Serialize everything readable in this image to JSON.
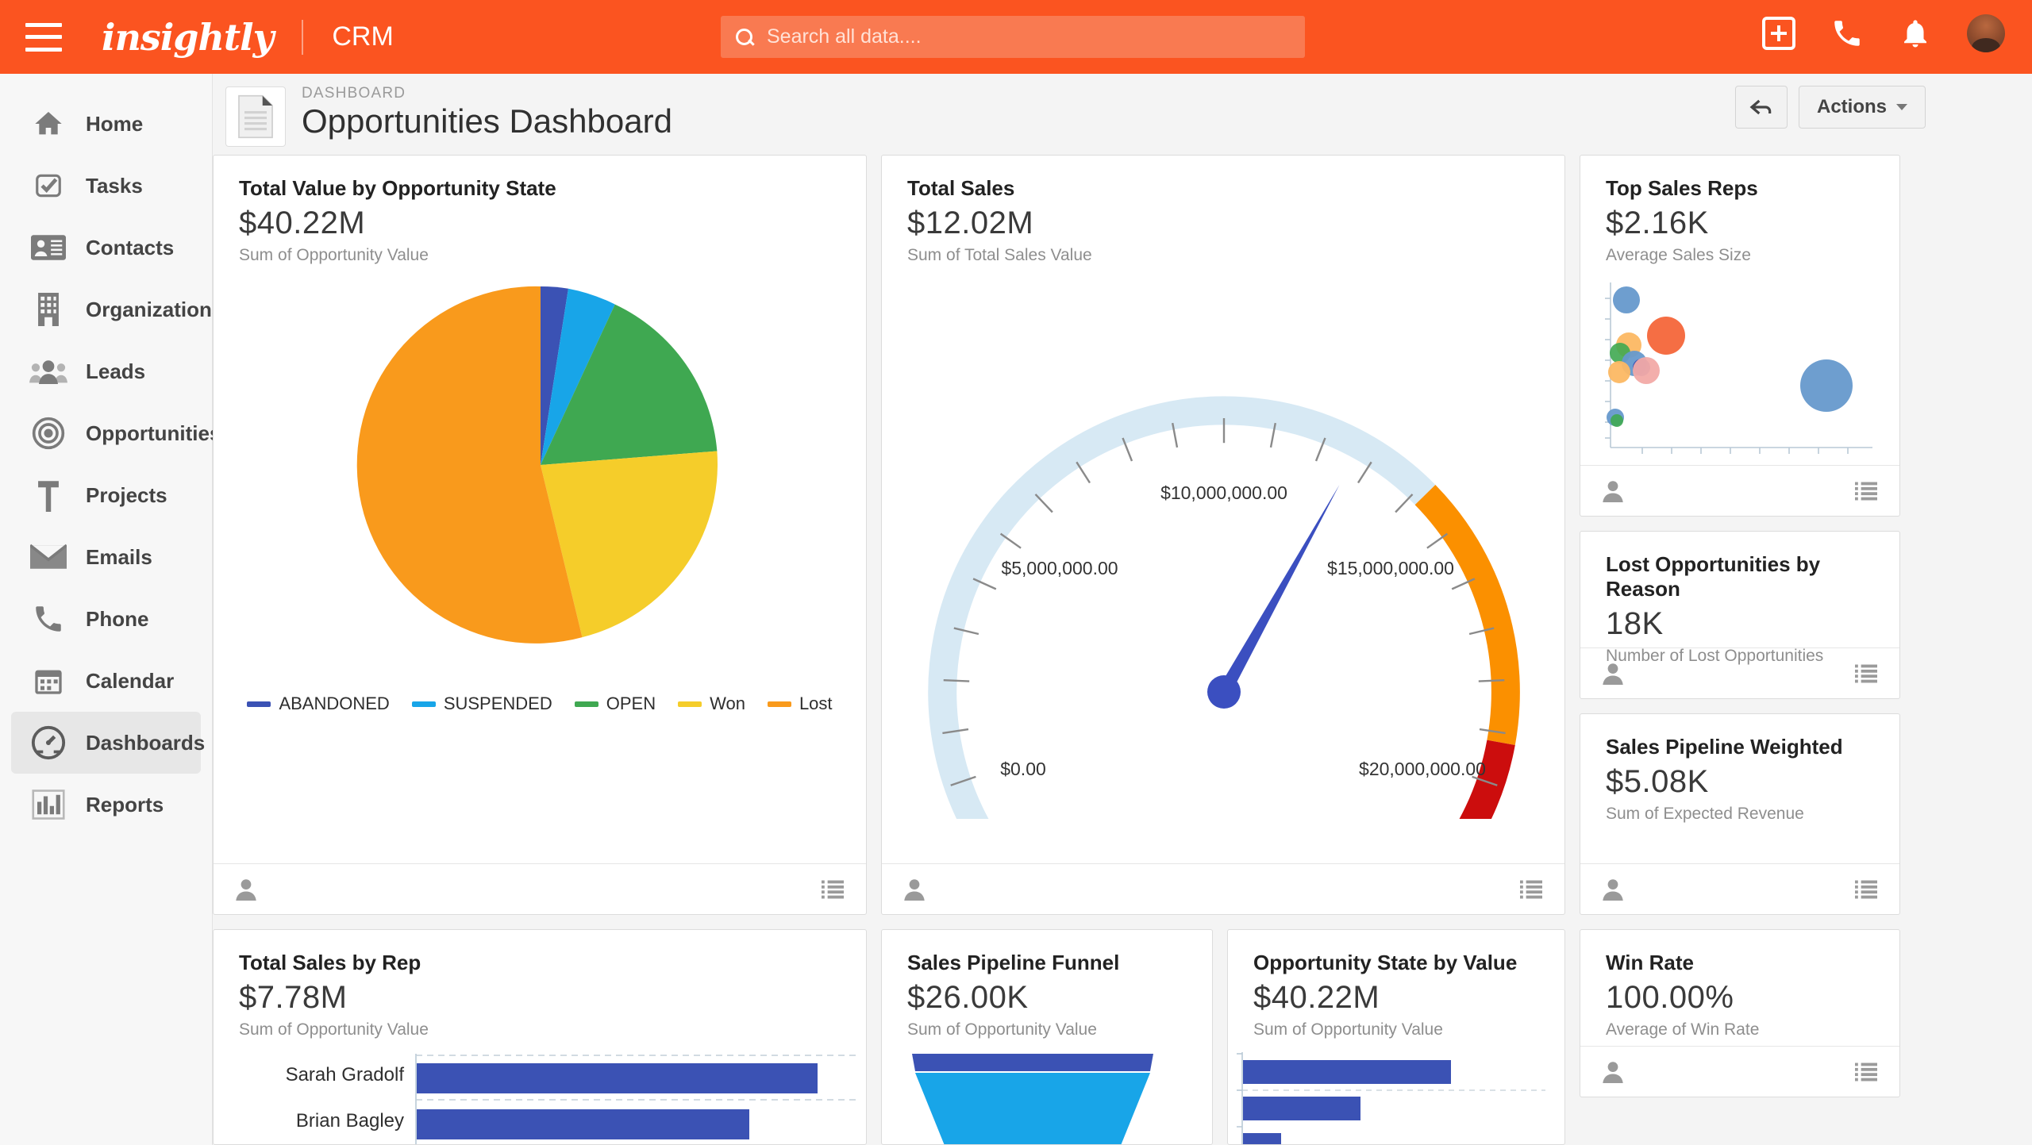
{
  "topbar": {
    "brand": "insightly",
    "app": "CRM",
    "search_placeholder": "Search all data....",
    "search_value": "",
    "icons": [
      "add-icon",
      "phone-icon",
      "bell-icon",
      "avatar"
    ]
  },
  "sidebar": {
    "items": [
      {
        "label": "Home",
        "icon": "home-icon",
        "active": false
      },
      {
        "label": "Tasks",
        "icon": "task-check-icon",
        "active": false
      },
      {
        "label": "Contacts",
        "icon": "contact-card-icon",
        "active": false
      },
      {
        "label": "Organizations",
        "icon": "building-icon",
        "active": false
      },
      {
        "label": "Leads",
        "icon": "people-icon",
        "active": false
      },
      {
        "label": "Opportunities",
        "icon": "target-icon",
        "active": false
      },
      {
        "label": "Projects",
        "icon": "hammer-icon",
        "active": false
      },
      {
        "label": "Emails",
        "icon": "envelope-icon",
        "active": false
      },
      {
        "label": "Phone",
        "icon": "phone-icon",
        "active": false
      },
      {
        "label": "Calendar",
        "icon": "calendar-icon",
        "active": false
      },
      {
        "label": "Dashboards",
        "icon": "gauge-icon",
        "active": true
      },
      {
        "label": "Reports",
        "icon": "bar-chart-icon",
        "active": false
      }
    ]
  },
  "header": {
    "breadcrumb": "DASHBOARD",
    "title": "Opportunities Dashboard",
    "back_label": "←",
    "actions_label": "Actions"
  },
  "colors": {
    "brand_orange": "#fb5420",
    "series_blue": "#3b52b4",
    "series_lightblue": "#18a5e8",
    "series_green": "#3fa851",
    "series_yellow": "#f5cd2a",
    "series_orange": "#f99a1c",
    "gauge_track": "#d7e9f4",
    "gauge_warn": "#fb9000",
    "gauge_danger": "#cc0d0d",
    "needle": "#3b4fc0"
  },
  "cards": [
    {
      "id": "total-value-by-opportunity-state",
      "title": "Total Value by Opportunity State",
      "value": "$40.22M",
      "subtitle": "Sum of Opportunity Value"
    },
    {
      "id": "total-sales",
      "title": "Total Sales",
      "value": "$12.02M",
      "subtitle": "Sum of Total Sales Value"
    },
    {
      "id": "top-sales-reps",
      "title": "Top Sales Reps",
      "value": "$2.16K",
      "subtitle": "Average Sales Size"
    },
    {
      "id": "lost-opportunities-by-reason",
      "title": "Lost Opportunities by Reason",
      "value": "18K",
      "subtitle": "Number of Lost Opportunities"
    },
    {
      "id": "sales-pipeline-weighted",
      "title": "Sales Pipeline Weighted",
      "value": "$5.08K",
      "subtitle": "Sum of Expected Revenue"
    },
    {
      "id": "total-sales-by-rep",
      "title": "Total Sales by Rep",
      "value": "$7.78M",
      "subtitle": "Sum of Opportunity Value"
    },
    {
      "id": "sales-pipeline-funnel",
      "title": "Sales Pipeline Funnel",
      "value": "$26.00K",
      "subtitle": "Sum of Opportunity Value"
    },
    {
      "id": "opportunity-state-by-value",
      "title": "Opportunity State by Value",
      "value": "$40.22M",
      "subtitle": "Sum of Opportunity Value"
    },
    {
      "id": "win-rate",
      "title": "Win Rate",
      "value": "100.00%",
      "subtitle": "Average of Win Rate"
    }
  ],
  "chart_data": [
    {
      "type": "pie",
      "title": "Total Value by Opportunity State",
      "legend_position": "bottom",
      "labels": [
        "ABANDONED",
        "SUSPENDED",
        "OPEN",
        "Won",
        "Lost"
      ],
      "values": [
        2.5,
        4.0,
        13.5,
        25.0,
        55.0
      ],
      "unit": "percent",
      "colors": [
        "#3b52b4",
        "#18a5e8",
        "#3fa851",
        "#f5cd2a",
        "#f99a1c"
      ]
    },
    {
      "type": "gauge",
      "title": "Total Sales",
      "value": 12020000,
      "value_label": "$12.02M",
      "min": 0,
      "max": 20000000,
      "tick_labels": [
        "$0.00",
        "$5,000,000.00",
        "$10,000,000.00",
        "$15,000,000.00",
        "$20,000,000.00"
      ],
      "bands": [
        {
          "from": 0,
          "to": 14000000,
          "color": "#d7e9f4"
        },
        {
          "from": 14000000,
          "to": 18000000,
          "color": "#fb9000"
        },
        {
          "from": 18000000,
          "to": 20000000,
          "color": "#cc0d0d"
        }
      ],
      "needle_color": "#3b4fc0"
    },
    {
      "type": "scatter",
      "title": "Top Sales Reps",
      "xlabel": "",
      "ylabel": "",
      "grid": false,
      "points": [
        {
          "x": 0.06,
          "y": 0.88,
          "r": 17,
          "color": "#6699cc"
        },
        {
          "x": 0.24,
          "y": 0.66,
          "r": 24,
          "color": "#f4663a"
        },
        {
          "x": 0.09,
          "y": 0.61,
          "r": 16,
          "color": "#fcb863"
        },
        {
          "x": 0.04,
          "y": 0.58,
          "r": 13,
          "color": "#3fa851"
        },
        {
          "x": 0.12,
          "y": 0.52,
          "r": 16,
          "color": "#6699cc"
        },
        {
          "x": 0.15,
          "y": 0.5,
          "r": 11,
          "color": "#3b52b4"
        },
        {
          "x": 0.17,
          "y": 0.48,
          "r": 17,
          "color": "#f2aaa6"
        },
        {
          "x": 0.03,
          "y": 0.46,
          "r": 14,
          "color": "#fcb863"
        },
        {
          "x": 0.02,
          "y": 0.18,
          "r": 11,
          "color": "#6699cc"
        },
        {
          "x": 0.025,
          "y": 0.16,
          "r": 8,
          "color": "#3fa851"
        },
        {
          "x": 0.85,
          "y": 0.38,
          "r": 33,
          "color": "#6699cc"
        }
      ]
    },
    {
      "type": "bar",
      "orientation": "horizontal",
      "title": "Total Sales by Rep",
      "categories": [
        "Sarah Gradolf",
        "Brian Bagley"
      ],
      "values": [
        100,
        83
      ],
      "color": "#3b52b4",
      "grid": true
    },
    {
      "type": "funnel",
      "title": "Sales Pipeline Funnel",
      "stages": [
        {
          "label": "",
          "width": 100,
          "color": "#3b52b4"
        },
        {
          "label": "",
          "width": 95,
          "color": "#18a5e8"
        }
      ]
    },
    {
      "type": "bar",
      "orientation": "horizontal",
      "title": "Opportunity State by Value",
      "categories": [
        "",
        "",
        ""
      ],
      "values": [
        100,
        56,
        18
      ],
      "color": "#3b52b4",
      "grid": true
    }
  ],
  "footer_icons": {
    "user": "user-icon",
    "list": "list-icon"
  }
}
